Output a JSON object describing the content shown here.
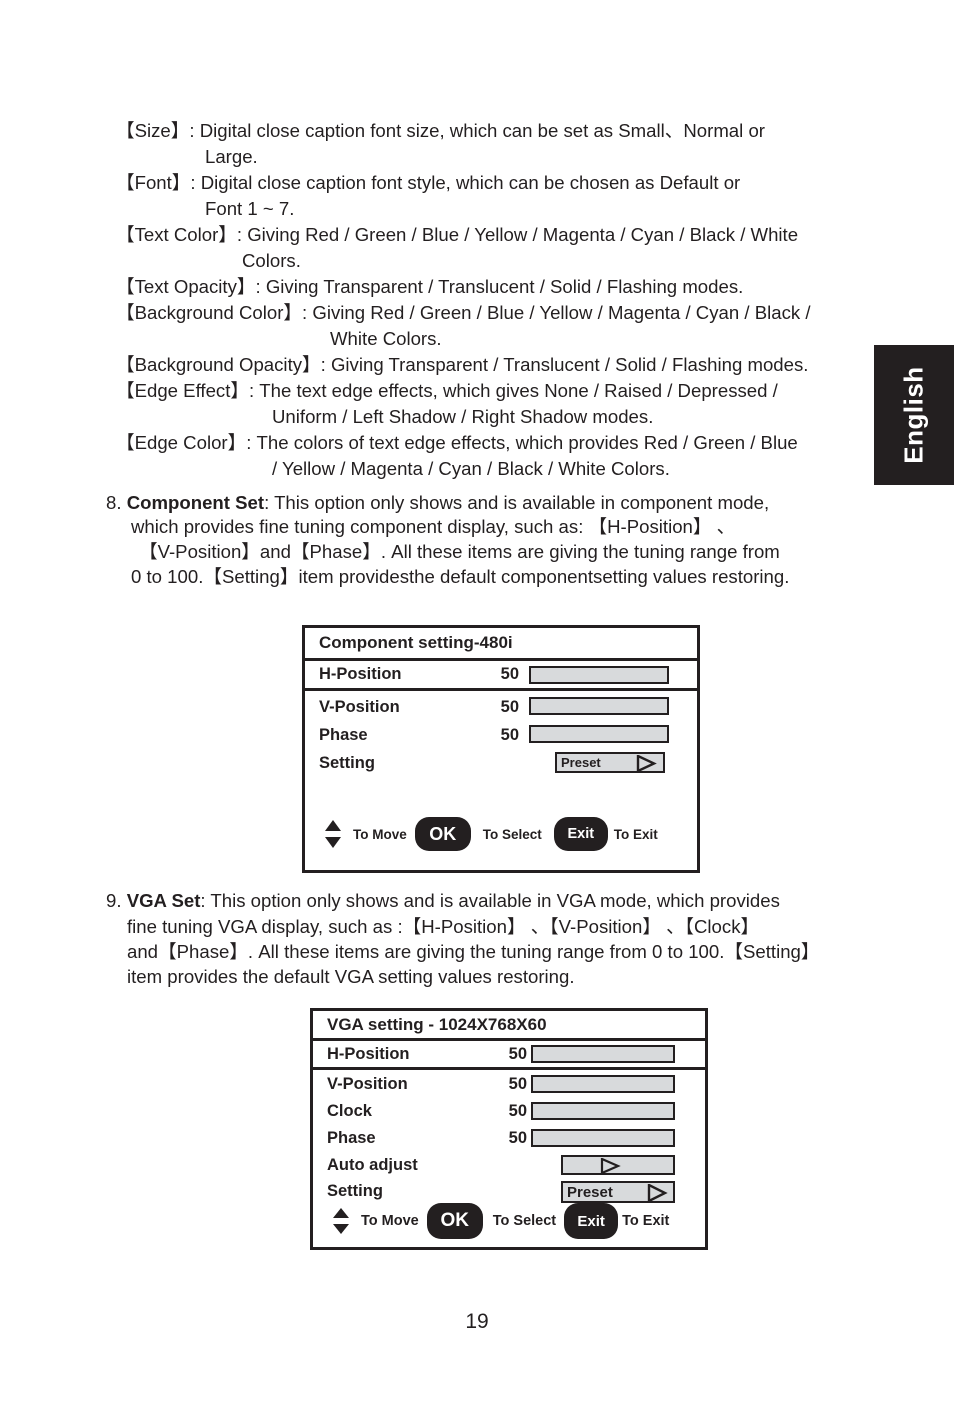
{
  "page": {
    "number": "19",
    "language_tab": "English"
  },
  "definitions": [
    {
      "term": "【Size】",
      "sep": ":",
      "lines": [
        "Digital  close  caption  font  size,  which  can  be  set  as  Small、Normal   or",
        "Large."
      ]
    },
    {
      "term": "【Font】",
      "sep": ":",
      "lines": [
        "Digital close caption font style, which can be chosen as Default or",
        "Font 1 ~ 7."
      ]
    },
    {
      "term": "【Text Color】",
      "sep": ":",
      "lines": [
        "Giving Red / Green / Blue / Yellow / Magenta / Cyan / Black / White",
        "Colors."
      ]
    },
    {
      "term": "【Text Opacity】",
      "sep": ":",
      "lines": [
        "Giving Transparent / Translucent / Solid / Flashing modes."
      ]
    },
    {
      "term": "【Background Color】",
      "sep": ":",
      "lines": [
        "Giving Red / Green / Blue / Yellow / Magenta / Cyan / Black /",
        "White Colors."
      ]
    },
    {
      "term": "【Background Opacity】",
      "sep": ":",
      "lines": [
        "Giving Transparent / Translucent / Solid / Flashing modes."
      ]
    },
    {
      "term": "【Edge Effect】",
      "sep": ":",
      "lines": [
        "The text edge effects, which gives None / Raised / Depressed  /",
        "Uniform / Left Shadow / Right Shadow modes."
      ]
    },
    {
      "term": "【Edge Color】",
      "sep": ":",
      "lines": [
        "The colors of text edge effects, which provides Red / Green / Blue",
        "/ Yellow / Magenta / Cyan / Black / White Colors."
      ]
    }
  ],
  "text_lines": {
    "l1a": "【Size】: Digital  close  caption  font  size,  which  can  be  set  as  Small、Normal   or",
    "l1b": "Large.",
    "l2a": "【Font】: Digital close caption font style, which can be chosen as Default or",
    "l2b": "Font 1 ~ 7.",
    "l3a": "【Text Color】: Giving Red / Green / Blue / Yellow / Magenta / Cyan / Black / White",
    "l3b": "Colors.",
    "l4a": "【Text Opacity】: Giving Transparent / Translucent / Solid / Flashing modes.",
    "l5a": "【Background Color】: Giving Red / Green / Blue / Yellow / Magenta / Cyan / Black /",
    "l5b": "White Colors.",
    "l6a": "【Background Opacity】: Giving Transparent / Translucent / Solid / Flashing modes.",
    "l7a": "【Edge Effect】: The text edge effects, which gives None / Raised / Depressed  /",
    "l7b": "Uniform / Left Shadow / Right Shadow modes.",
    "l8a": "【Edge Color】: The colors of text edge effects, which provides Red / Green / Blue",
    "l8b": "/ Yellow / Magenta / Cyan / Black / White Colors."
  },
  "item8": {
    "number": "8.",
    "title": "Component Set",
    "line1_rest": ": This option only shows and is available in component  mode,",
    "line2": "which provides fine tuning component display, such as:  【H-Position】 、",
    "line3": "【V-Position】and【Phase】. All these items are giving the tuning range from",
    "line4": "0 to 100.【Setting】item providesthe default componentsetting values restoring."
  },
  "item9": {
    "number": "9.",
    "title": "VGA Set",
    "line1_rest": ": This option only shows and is available in VGA mode, which provides",
    "line2": "fine tuning VGA display, such as :【H-Position】 、【V-Position】 、【Clock】",
    "line3": "and【Phase】. All these items  are giving the tuning range from 0 to 100.【Setting】",
    "line4": "item provides the default VGA setting values restoring."
  },
  "osd_component": {
    "title": "Component setting-480i",
    "rows": [
      {
        "label": "H-Position",
        "value": "50",
        "fill_percent": 50,
        "selected": true,
        "control": "bar"
      },
      {
        "label": "V-Position",
        "value": "50",
        "fill_percent": 50,
        "selected": false,
        "control": "bar"
      },
      {
        "label": "Phase",
        "value": "50",
        "fill_percent": 50,
        "selected": false,
        "control": "bar"
      },
      {
        "label": "Setting",
        "value": "",
        "button_label": "Preset",
        "selected": false,
        "control": "button"
      }
    ],
    "footer": {
      "move_icon": "up-down-arrow-icon",
      "move_label": "To Move",
      "ok_label": "OK",
      "select_label": "To Select",
      "exit_label": "Exit",
      "exit_hint": "To Exit"
    }
  },
  "osd_vga": {
    "title": "VGA setting - 1024X768X60",
    "rows": [
      {
        "label": "H-Position",
        "value": "50",
        "fill_percent": 50,
        "selected": true,
        "control": "bar"
      },
      {
        "label": "V-Position",
        "value": "50",
        "fill_percent": 50,
        "selected": false,
        "control": "bar"
      },
      {
        "label": "Clock",
        "value": "50",
        "fill_percent": 50,
        "selected": false,
        "control": "bar"
      },
      {
        "label": "Phase",
        "value": "50",
        "fill_percent": 50,
        "selected": false,
        "control": "bar"
      },
      {
        "label": "Auto adjust",
        "value": "",
        "button_label": "",
        "selected": false,
        "control": "arrow-button"
      },
      {
        "label": "Setting",
        "value": "",
        "button_label": "Preset",
        "selected": false,
        "control": "button"
      }
    ],
    "footer": {
      "move_icon": "up-down-arrow-icon",
      "move_label": "To Move",
      "ok_label": "OK",
      "select_label": "To Select",
      "exit_label": "Exit",
      "exit_hint": "To Exit"
    }
  },
  "colors": {
    "ink": "#231f20",
    "bar_track": "#d8dadc",
    "bar_fill": "#231f20",
    "paper": "#ffffff"
  }
}
